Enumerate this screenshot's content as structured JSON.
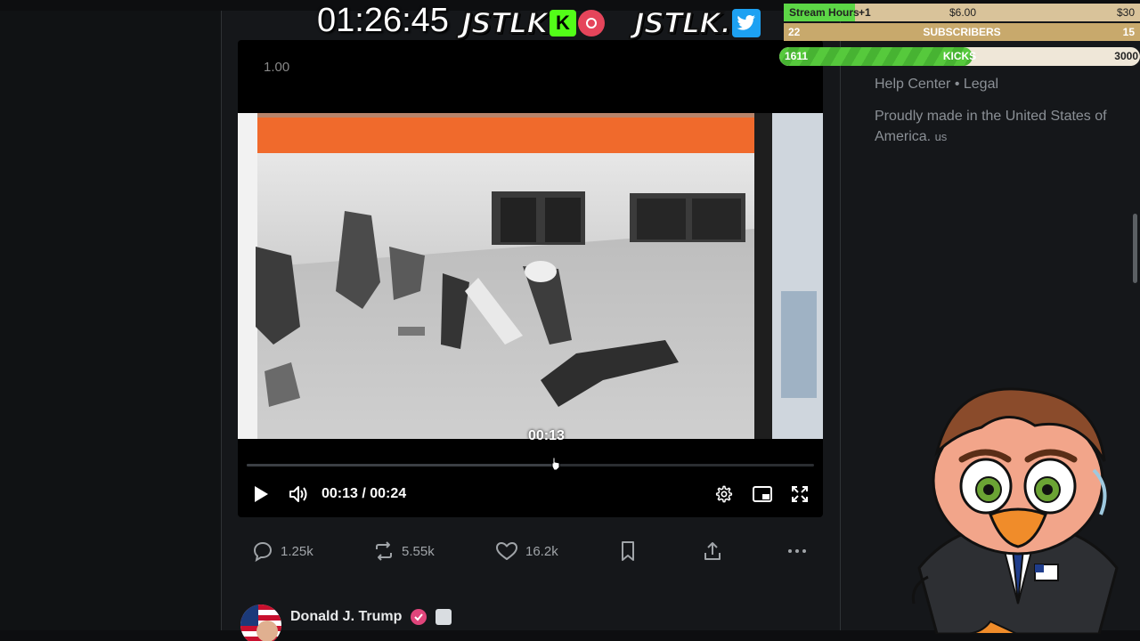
{
  "overlay": {
    "timer": "01:26:45",
    "logo_kick_text": "JSTLK",
    "logo_kick_badge": "K",
    "logo_twitter_text": "JSTLK",
    "goal_stream_hours": {
      "label": "Stream Hours",
      "increment": "+1",
      "amount": "$6.00",
      "target": "$30",
      "progress": 0.2
    },
    "goal_subscribers": {
      "current": "22",
      "label": "SUBSCRIBERS",
      "target": "15"
    },
    "goal_kicks": {
      "current": "1611",
      "label": "KICKS",
      "target": "3000",
      "progress": 0.537
    }
  },
  "video": {
    "speed": "1.00",
    "hover_time": "00:13",
    "current_time": "00:13",
    "duration": "00:24",
    "time_display": "00:13 / 00:24",
    "progress": 0.54
  },
  "post_actions": {
    "replies": "1.25k",
    "reposts": "5.55k",
    "likes": "16.2k"
  },
  "next_post": {
    "author": "Donald J. Trump"
  },
  "sidebar": {
    "footer_links": "Help Center • Legal",
    "made_in": "Proudly made in the United States of America.",
    "made_in_flag": "us"
  },
  "colors": {
    "kick_green": "#53fc18",
    "twitter_blue": "#1da1f2",
    "verified_pink": "#e0457b"
  }
}
